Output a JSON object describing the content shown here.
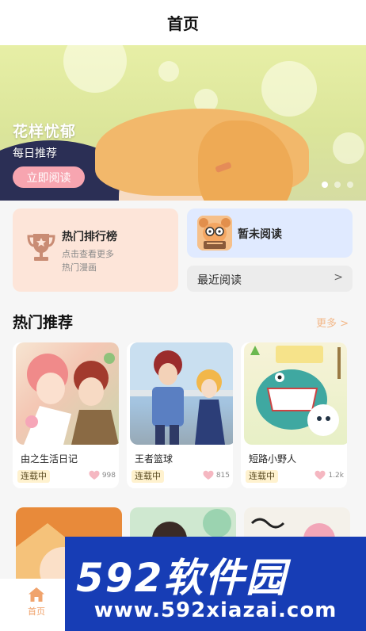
{
  "header": {
    "title": "首页"
  },
  "banner": {
    "title": "花样忧郁",
    "subtitle": "每日推荐",
    "button_label": "立即阅读",
    "slide_count": 3,
    "active_slide": 1
  },
  "shortcuts": {
    "ranking": {
      "title": "热门排行榜",
      "desc_line1": "点击查看更多",
      "desc_line2": "热门漫画",
      "icon": "trophy-icon"
    },
    "reading": {
      "title": "暂未阅读",
      "icon": "avatar"
    },
    "recent": {
      "label": "最近阅读",
      "arrow": ">"
    }
  },
  "hot": {
    "title": "热门推荐",
    "more_label": "更多 >",
    "items": [
      {
        "name": "由之生活日记",
        "status": "连载中",
        "likes": "998"
      },
      {
        "name": "王者篮球",
        "status": "连载中",
        "likes": "815"
      },
      {
        "name": "短路小野人",
        "status": "连载中",
        "likes": "1.2k"
      }
    ]
  },
  "tabbar": {
    "home_label": "首页",
    "home_icon": "home-icon"
  },
  "watermark": {
    "brand": "592软件园",
    "url": "www.592xiazai.com"
  },
  "colors": {
    "accent": "#f0a36c",
    "banner_button": "#f7a5b0",
    "rank_bg": "#fde5d9",
    "reading_bg": "#e0eaff",
    "watermark_bg": "#173db5"
  }
}
